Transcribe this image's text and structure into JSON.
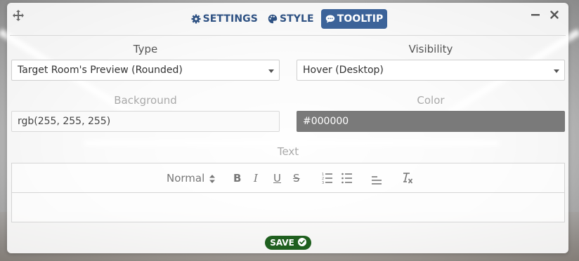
{
  "tabs": [
    {
      "label": "SETTINGS",
      "icon": "gear-icon",
      "active": false
    },
    {
      "label": "STYLE",
      "icon": "palette-icon",
      "active": false
    },
    {
      "label": "TOOLTIP",
      "icon": "comment-icon",
      "active": true
    }
  ],
  "fields": {
    "type": {
      "label": "Type",
      "value": "Target Room's Preview (Rounded)"
    },
    "visibility": {
      "label": "Visibility",
      "value": "Hover (Desktop)"
    },
    "background": {
      "label": "Background",
      "value": "rgb(255, 255, 255)"
    },
    "color": {
      "label": "Color",
      "value": "#000000"
    }
  },
  "editor": {
    "label": "Text",
    "format": "Normal",
    "buttons": [
      "bold-icon",
      "italic-icon",
      "underline-icon",
      "strike-icon",
      "ordered-list-icon",
      "bullet-list-icon",
      "align-icon",
      "clear-format-icon"
    ],
    "bold": "B",
    "italic": "I",
    "underline": "U",
    "strike": "S"
  },
  "save": {
    "label": "SAVE"
  },
  "colors": {
    "accent": "#3c6399",
    "save": "#1f5f1f",
    "color_swatch": "#7a7a7a"
  }
}
